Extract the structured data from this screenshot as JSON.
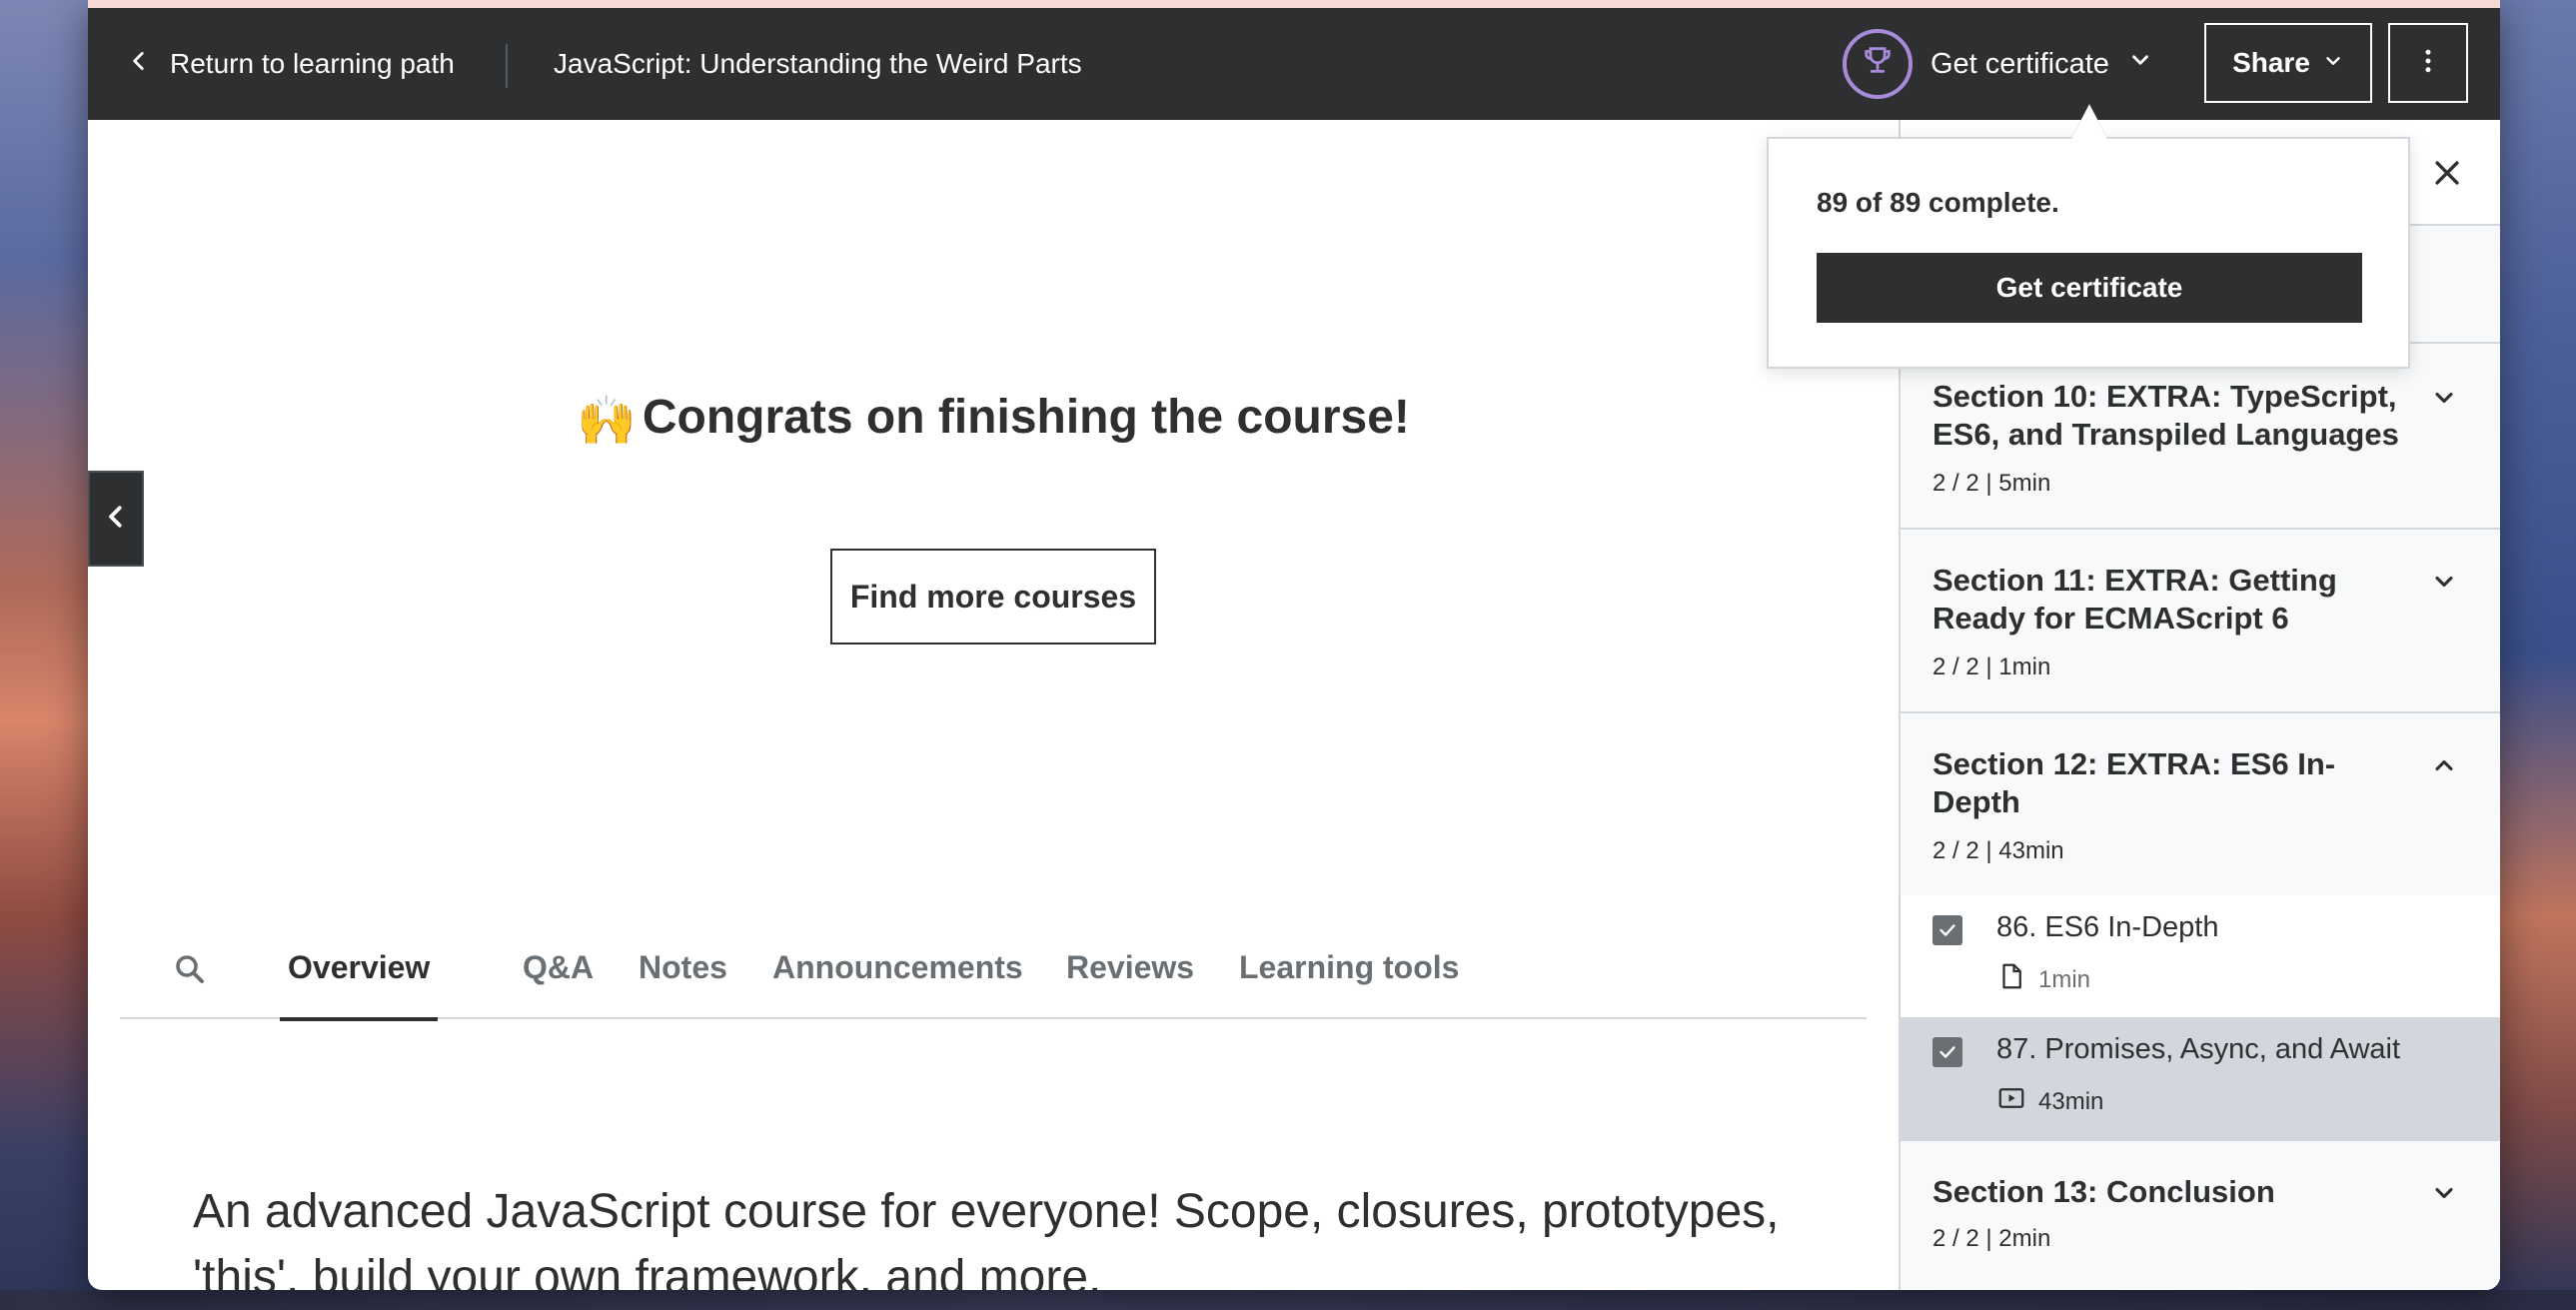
{
  "header": {
    "back_label": "Return to learning path",
    "course_title": "JavaScript: Understanding the Weird Parts",
    "certificate_label": "Get certificate",
    "share_label": "Share"
  },
  "popover": {
    "progress_text": "89 of 89 complete.",
    "button_label": "Get certificate"
  },
  "main": {
    "congrats_emoji": "🙌",
    "congrats_text": "Congrats on finishing the course!",
    "find_courses_label": "Find more courses",
    "tabs": [
      {
        "label": "Overview",
        "active": true
      },
      {
        "label": "Q&A"
      },
      {
        "label": "Notes"
      },
      {
        "label": "Announcements"
      },
      {
        "label": "Reviews"
      },
      {
        "label": "Learning tools"
      }
    ],
    "description": "An advanced JavaScript course for everyone! Scope, closures, prototypes, 'this', build your own framework, and more."
  },
  "sidebar": {
    "sections": [
      {
        "title": "Section 10: EXTRA: TypeScript, ES6, and Transpiled Languages",
        "meta": "2 / 2 | 5min",
        "expanded": false
      },
      {
        "title": "Section 11: EXTRA: Getting Ready for ECMAScript 6",
        "meta": "2 / 2 | 1min",
        "expanded": false
      },
      {
        "title": "Section 12: EXTRA: ES6 In-Depth",
        "meta": "2 / 2 | 43min",
        "expanded": true
      },
      {
        "title": "Section 13: Conclusion",
        "meta": "2 / 2 | 2min",
        "expanded": false
      }
    ],
    "lectures": [
      {
        "title": "86. ES6 In-Depth",
        "duration": "1min",
        "icon": "file-icon",
        "completed": true
      },
      {
        "title": "87. Promises, Async, and Await",
        "duration": "43min",
        "icon": "video-icon",
        "completed": true,
        "current": true
      }
    ]
  },
  "colors": {
    "topbar": "#2d2f31",
    "trophy_accent": "#a78bd9",
    "border": "#d1d7dc",
    "muted_text": "#6a6f73"
  }
}
